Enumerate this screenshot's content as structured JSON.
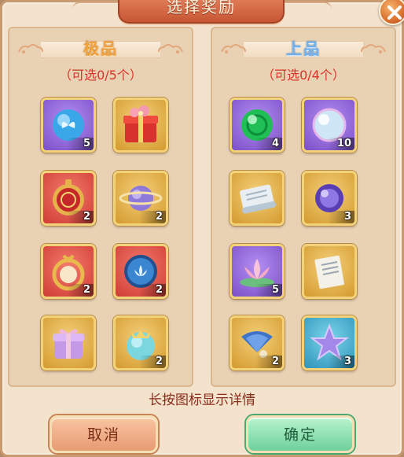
{
  "title": "选择奖励",
  "panels": {
    "left": {
      "label": "极品",
      "count": "（可选0/5个）",
      "items": [
        {
          "icon": "blue-butterfly-orb-icon",
          "qty": "5",
          "quality": "purple"
        },
        {
          "icon": "red-gift-box-icon",
          "qty": "",
          "quality": "gold"
        },
        {
          "icon": "red-seal-token-icon",
          "qty": "2",
          "quality": "red"
        },
        {
          "icon": "planet-ring-icon",
          "qty": "2",
          "quality": "gold"
        },
        {
          "icon": "golden-ring-pearl-icon",
          "qty": "2",
          "quality": "red"
        },
        {
          "icon": "blue-lotus-orb-icon",
          "qty": "2",
          "quality": "red"
        },
        {
          "icon": "purple-gift-box-icon",
          "qty": "",
          "quality": "gold"
        },
        {
          "icon": "crowned-teal-orb-icon",
          "qty": "2",
          "quality": "gold"
        }
      ]
    },
    "right": {
      "label": "上品",
      "count": "（可选0/4个）",
      "items": [
        {
          "icon": "green-orb-icon",
          "qty": "4",
          "quality": "purple"
        },
        {
          "icon": "pearl-orb-icon",
          "qty": "10",
          "quality": "purple"
        },
        {
          "icon": "scroll-icon",
          "qty": "",
          "quality": "gold"
        },
        {
          "icon": "purple-orb-icon",
          "qty": "3",
          "quality": "gold"
        },
        {
          "icon": "pink-lotus-icon",
          "qty": "5",
          "quality": "purple"
        },
        {
          "icon": "paper-note-icon",
          "qty": "",
          "quality": "gold"
        },
        {
          "icon": "blue-fan-icon",
          "qty": "2",
          "quality": "gold"
        },
        {
          "icon": "purple-star-icon",
          "qty": "3",
          "quality": "blue"
        }
      ]
    }
  },
  "hint": "长按图标显示详情",
  "buttons": {
    "cancel": "取消",
    "confirm": "确定"
  },
  "colors": {
    "count_text": "#d8342a",
    "jipin_label": "#f0a03a",
    "shangpin_label": "#6fb0ec",
    "hint_text": "#8a2d1a"
  }
}
